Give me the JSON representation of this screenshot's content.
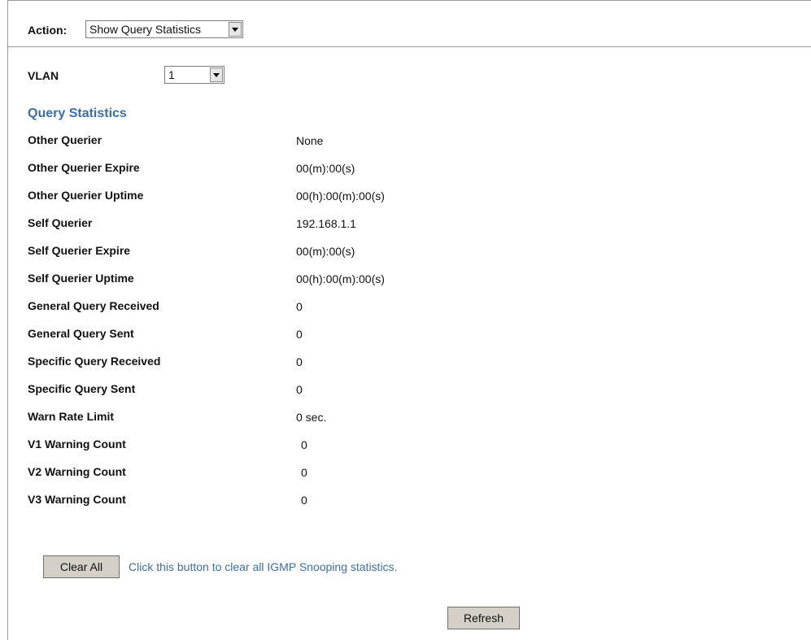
{
  "action": {
    "label": "Action:",
    "selected": "Show Query Statistics"
  },
  "vlan": {
    "label": "VLAN",
    "selected": "1"
  },
  "section_title": "Query Statistics",
  "stats": [
    {
      "label": "Other Querier",
      "value": "None"
    },
    {
      "label": "Other Querier Expire",
      "value": "00(m):00(s)"
    },
    {
      "label": "Other Querier Uptime",
      "value": "00(h):00(m):00(s)"
    },
    {
      "label": "Self Querier",
      "value": "192.168.1.1"
    },
    {
      "label": "Self Querier Expire",
      "value": "00(m):00(s)"
    },
    {
      "label": "Self Querier Uptime",
      "value": "00(h):00(m):00(s)"
    },
    {
      "label": "General Query Received",
      "value": "0"
    },
    {
      "label": "General Query Sent",
      "value": "0"
    },
    {
      "label": "Specific Query Received",
      "value": "0"
    },
    {
      "label": "Specific Query Sent",
      "value": "0"
    },
    {
      "label": "Warn Rate Limit",
      "value": "0 sec."
    },
    {
      "label": "V1 Warning Count",
      "value": "0"
    },
    {
      "label": "V2 Warning Count",
      "value": "0"
    },
    {
      "label": "V3 Warning Count",
      "value": "0"
    }
  ],
  "clear_button": {
    "label": "Clear All",
    "hint": "Click this button to clear all IGMP Snooping statistics."
  },
  "refresh_button": {
    "label": "Refresh"
  },
  "colors": {
    "section_title": "#3a6ea5",
    "button_bg": "#d4d0c8"
  },
  "icons": {
    "dropdown": "chevron-down-icon"
  }
}
